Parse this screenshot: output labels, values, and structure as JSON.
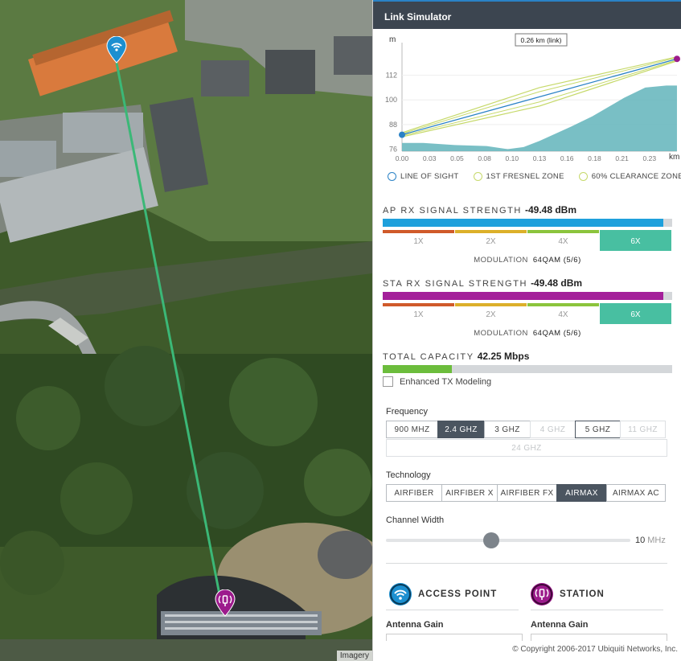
{
  "map": {
    "imagery_credit": "Imagery",
    "link_color": "#3bb877"
  },
  "panel": {
    "title": "Link Simulator",
    "copyright": "© Copyright 2006-2017 Ubiquiti Networks, Inc."
  },
  "chart_data": {
    "type": "area",
    "link_label": "0.26 km (link)",
    "xlabel": "km",
    "ylabel": "m",
    "x_ticks": [
      "0.00",
      "0.03",
      "0.05",
      "0.08",
      "0.10",
      "0.13",
      "0.16",
      "0.18",
      "0.21",
      "0.23"
    ],
    "y_ticks": [
      "76",
      "88",
      "100",
      "112"
    ],
    "xlim": [
      0,
      0.26
    ],
    "ylim": [
      75,
      124
    ],
    "terrain": {
      "x": [
        0,
        0.02,
        0.05,
        0.08,
        0.1,
        0.115,
        0.13,
        0.16,
        0.18,
        0.21,
        0.23,
        0.25,
        0.26
      ],
      "y": [
        79,
        79,
        78,
        77.5,
        76,
        77,
        80,
        87,
        92,
        101,
        106,
        107,
        107
      ]
    },
    "line_of_sight": {
      "x": [
        0,
        0.26
      ],
      "y": [
        83,
        120
      ]
    },
    "fresnel_upper": {
      "x": [
        0,
        0.13,
        0.26
      ],
      "y": [
        84,
        106,
        121
      ]
    },
    "fresnel_lower": {
      "x": [
        0,
        0.13,
        0.26
      ],
      "y": [
        82,
        97,
        119
      ]
    },
    "clearance_upper": {
      "x": [
        0,
        0.13,
        0.26
      ],
      "y": [
        83.5,
        104,
        120.6
      ]
    },
    "clearance_lower": {
      "x": [
        0,
        0.13,
        0.26
      ],
      "y": [
        82.5,
        99,
        119.4
      ]
    },
    "colors": {
      "terrain": "#6ab8bf",
      "line_of_sight": "#2a82c6",
      "fresnel": "#c6d96a",
      "start_point": "#2a82c6",
      "end_point": "#9c1b8c"
    }
  },
  "legend": [
    {
      "label": "LINE OF SIGHT",
      "color": "#2a82c6"
    },
    {
      "label": "1ST FRESNEL ZONE",
      "color": "#c6d96a"
    },
    {
      "label": "60% CLEARANCE ZONE",
      "color": "#c6d96a"
    }
  ],
  "ap": {
    "title": "AP RX SIGNAL STRENGTH",
    "value": "-49.48 dBm",
    "fill_fraction": 0.97,
    "bar_color": "#1ea0dc",
    "modulation_label": "MODULATION",
    "modulation_value": "64QAM (5/6)"
  },
  "sta": {
    "title": "STA RX SIGNAL STRENGTH",
    "value": "-49.48 dBm",
    "fill_fraction": 0.97,
    "bar_color": "#a4209a",
    "modulation_label": "MODULATION",
    "modulation_value": "64QAM (5/6)"
  },
  "mod_levels": [
    {
      "label": "1X",
      "color": "#d05a2a"
    },
    {
      "label": "2X",
      "color": "#dcb02a"
    },
    {
      "label": "4X",
      "color": "#8bc43c"
    },
    {
      "label": "6X",
      "color": "#48bfa1",
      "active": true
    }
  ],
  "capacity": {
    "title": "TOTAL CAPACITY",
    "value": "42.25 Mbps",
    "fill_fraction": 0.24,
    "bar_color": "#6cbd3c"
  },
  "enhanced_tx": {
    "label": "Enhanced TX Modeling",
    "checked": false
  },
  "frequency": {
    "label": "Frequency",
    "options": [
      {
        "label": "900 MHZ",
        "state": "normal"
      },
      {
        "label": "2.4 GHZ",
        "state": "active"
      },
      {
        "label": "3 GHZ",
        "state": "normal"
      },
      {
        "label": "4 GHZ",
        "state": "disabled"
      },
      {
        "label": "5 GHZ",
        "state": "outlined"
      },
      {
        "label": "11 GHZ",
        "state": "disabled"
      }
    ],
    "extra_option": "24 GHZ"
  },
  "technology": {
    "label": "Technology",
    "options": [
      {
        "label": "AIRFIBER",
        "state": "normal"
      },
      {
        "label": "AIRFIBER X",
        "state": "normal"
      },
      {
        "label": "AIRFIBER FX",
        "state": "normal"
      },
      {
        "label": "AIRMAX",
        "state": "active"
      },
      {
        "label": "AIRMAX AC",
        "state": "normal"
      }
    ]
  },
  "channel_width": {
    "label": "Channel Width",
    "value": "10",
    "unit": "MHz",
    "slider_fraction": 0.43
  },
  "devices": {
    "access_point": {
      "title": "ACCESS POINT",
      "gain_label": "Antenna Gain",
      "color": "#1c8fd0"
    },
    "station": {
      "title": "STATION",
      "gain_label": "Antenna Gain",
      "color": "#9c1b8c"
    }
  }
}
